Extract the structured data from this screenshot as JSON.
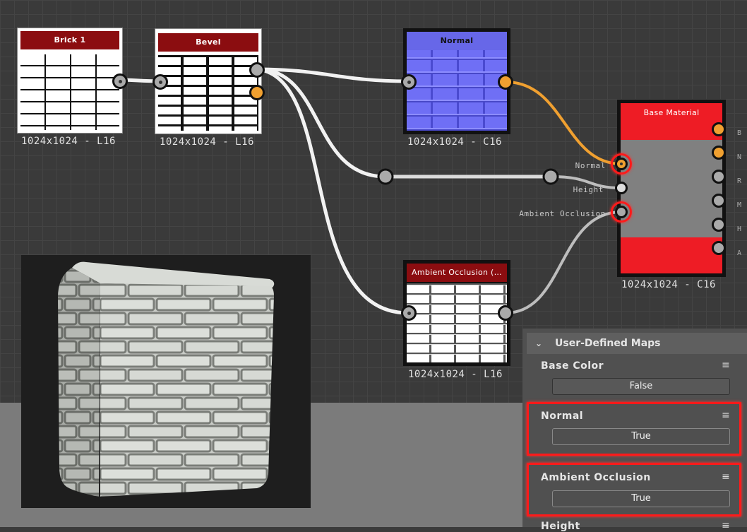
{
  "nodes": {
    "brick": {
      "title": "Brick 1",
      "resolution": "1024x1024 - L16"
    },
    "bevel": {
      "title": "Bevel",
      "resolution": "1024x1024 - L16"
    },
    "normal": {
      "title": "Normal",
      "resolution": "1024x1024 - C16"
    },
    "ao": {
      "title": "Ambient Occlusion (…",
      "resolution": "1024x1024 - L16"
    },
    "base": {
      "title": "Base Material",
      "resolution": "1024x1024 - C16",
      "inputs": {
        "normal": "Normal",
        "height": "Height",
        "ao": "Ambient Occlusion"
      },
      "output_stubs": [
        "B",
        "N",
        "R",
        "M",
        "H",
        "A"
      ]
    }
  },
  "panel": {
    "title": "User-Defined Maps",
    "items": [
      {
        "label": "Base Color",
        "value": "False"
      },
      {
        "label": "Normal",
        "value": "True"
      },
      {
        "label": "Ambient Occlusion",
        "value": "True"
      },
      {
        "label": "Height",
        "value": ""
      }
    ]
  },
  "colors": {
    "header": "#8b0d10",
    "orange_port": "#f0a030",
    "highlight": "#ff1a1a",
    "base_material": "#ee1c25",
    "normal_map": "#6f6ff5"
  },
  "icons": {
    "menu": "list-menu-icon",
    "chevron": "chevron-down-icon"
  }
}
